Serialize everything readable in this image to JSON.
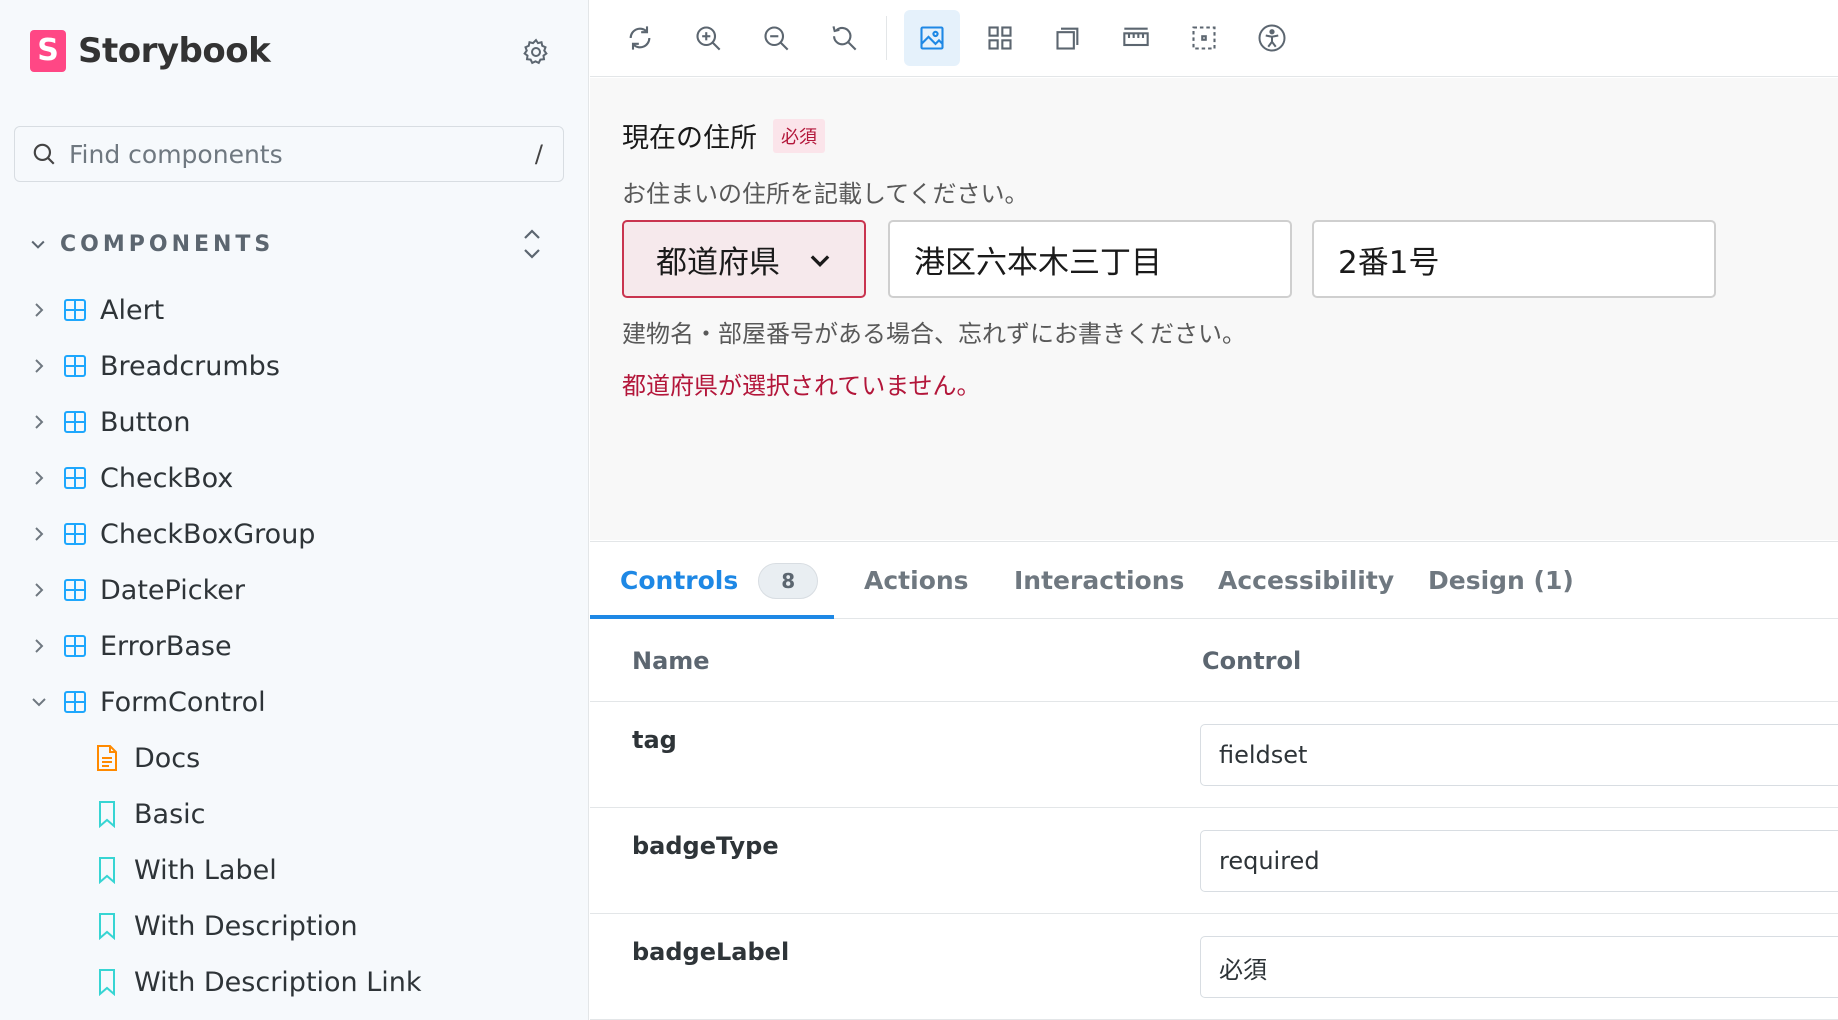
{
  "app": {
    "name": "Storybook"
  },
  "sidebar": {
    "search": {
      "placeholder": "Find components",
      "shortcut": "/"
    },
    "section_label": "COMPONENTS",
    "items": [
      {
        "label": "Alert"
      },
      {
        "label": "Breadcrumbs"
      },
      {
        "label": "Button"
      },
      {
        "label": "CheckBox"
      },
      {
        "label": "CheckBoxGroup"
      },
      {
        "label": "DatePicker"
      },
      {
        "label": "ErrorBase"
      },
      {
        "label": "FormControl"
      }
    ],
    "children": [
      {
        "label": "Docs",
        "icon": "document-icon"
      },
      {
        "label": "Basic",
        "icon": "bookmark-icon"
      },
      {
        "label": "With Label",
        "icon": "bookmark-icon"
      },
      {
        "label": "With Description",
        "icon": "bookmark-icon"
      },
      {
        "label": "With Description Link",
        "icon": "bookmark-icon"
      }
    ]
  },
  "toolbar": {
    "buttons": [
      "reload-icon",
      "zoom-in-icon",
      "zoom-out-icon",
      "reset-zoom-icon",
      "background-icon",
      "grid-icon",
      "viewport-icon",
      "measure-icon",
      "outline-icon",
      "accessibility-icon"
    ],
    "active": "background-icon"
  },
  "preview": {
    "label": "現在の住所",
    "badge": "必須",
    "description": "お住まいの住所を記載してください。",
    "select_value": "都道府県",
    "address_value": "港区六本木三丁目",
    "number_value": "2番1号",
    "note": "建物名・部屋番号がある場合、忘れずにお書きください。",
    "error": "都道府県が選択されていません。"
  },
  "panel": {
    "tabs": [
      {
        "label": "Controls",
        "count": "8"
      },
      {
        "label": "Actions"
      },
      {
        "label": "Interactions"
      },
      {
        "label": "Accessibility"
      },
      {
        "label": "Design (1)"
      }
    ],
    "headers": {
      "name": "Name",
      "control": "Control"
    },
    "rows": [
      {
        "name": "tag",
        "value": "fieldset"
      },
      {
        "name": "badgeType",
        "value": "required"
      },
      {
        "name": "badgeLabel",
        "value": "必須"
      }
    ]
  },
  "colors": {
    "accent": "#1e88e5",
    "brand": "#ff4785",
    "error": "#b3163a",
    "component_icon": "#1ea7fd",
    "docs_icon": "#ff8a00",
    "story_icon": "#37d5d3"
  }
}
